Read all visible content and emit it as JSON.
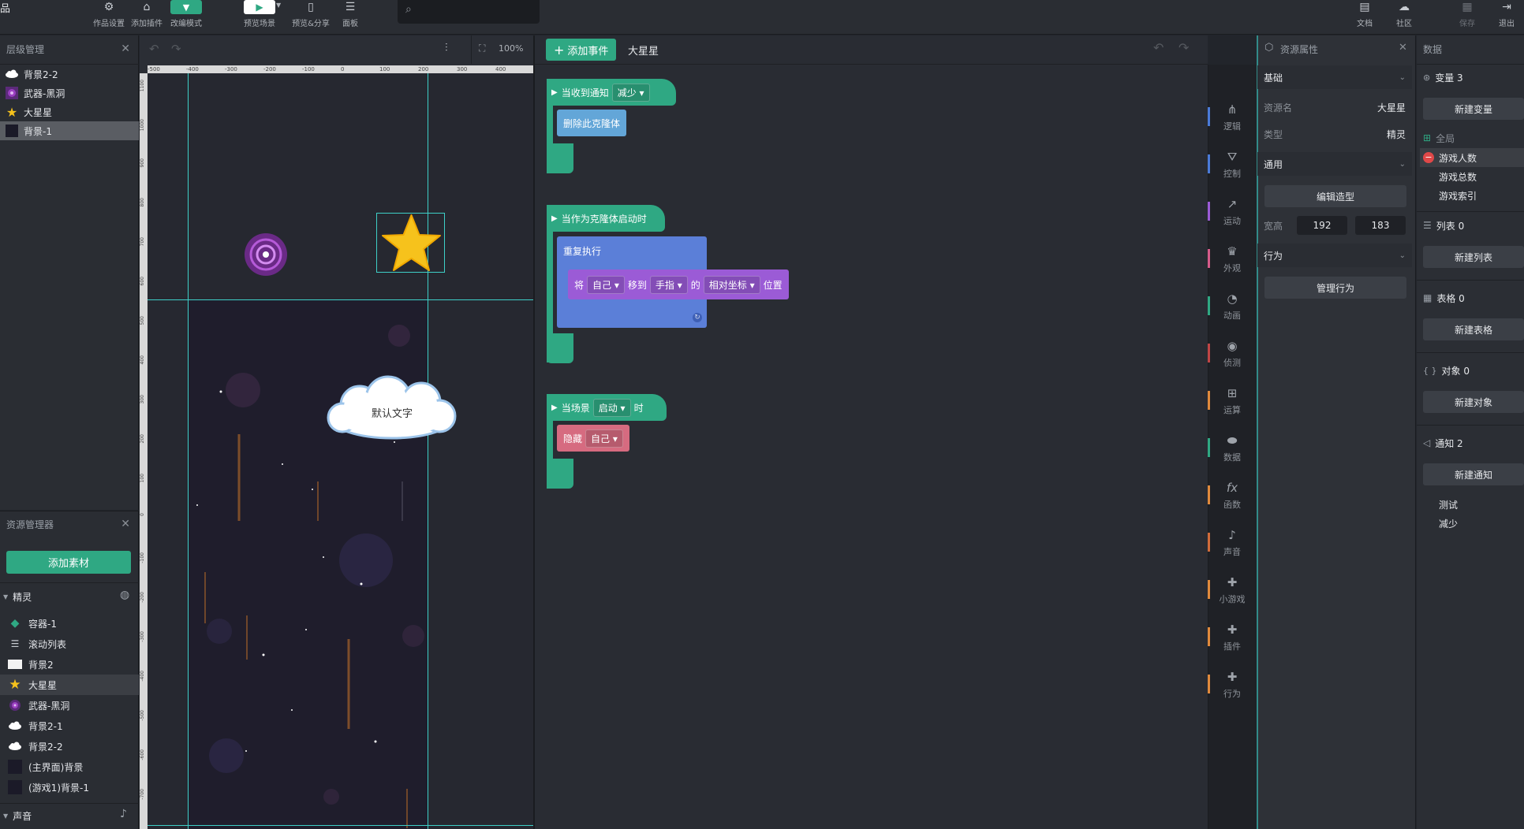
{
  "topbar": {
    "app_glyph": "品",
    "buttons": [
      {
        "label": "作品设置",
        "icon": "gear-icon"
      },
      {
        "label": "添加插件",
        "icon": "plugin-icon"
      },
      {
        "label": "改编模式",
        "icon": "shirt-icon"
      },
      {
        "label": "预览场景",
        "icon": "play-icon"
      },
      {
        "label": "预览&分享",
        "icon": "phone-icon"
      },
      {
        "label": "面板",
        "icon": "list-icon"
      }
    ],
    "right_buttons": [
      {
        "label": "文档",
        "icon": "book-icon"
      },
      {
        "label": "社区",
        "icon": "chat-icon"
      },
      {
        "label": "保存",
        "icon": "save-icon"
      },
      {
        "label": "退出",
        "icon": "exit-icon"
      }
    ]
  },
  "layers": {
    "title": "层级管理",
    "items": [
      {
        "label": "背景2-2",
        "icon": "cloud-icon",
        "selected": false
      },
      {
        "label": "武器-黑洞",
        "icon": "blackhole-icon",
        "selected": false
      },
      {
        "label": "大星星",
        "icon": "star-icon",
        "selected": false
      },
      {
        "label": "背景-1",
        "icon": "dark-square-icon",
        "selected": true
      }
    ]
  },
  "assets": {
    "title": "资源管理器",
    "add_button": "添加素材",
    "sprite_section": "精灵",
    "sprites": [
      {
        "label": "容器-1",
        "icon": "cube-icon"
      },
      {
        "label": "滚动列表",
        "icon": "list-icon"
      },
      {
        "label": "背景2",
        "icon": "white-rect-icon"
      },
      {
        "label": "大星星",
        "icon": "star-icon"
      },
      {
        "label": "武器-黑洞",
        "icon": "blackhole-icon"
      },
      {
        "label": "背景2-1",
        "icon": "cloud-icon"
      },
      {
        "label": "背景2-2",
        "icon": "cloud-icon"
      },
      {
        "label": "(主界面)背景",
        "icon": "dark-square-icon"
      },
      {
        "label": "(游戏1)背景-1",
        "icon": "dark-square-icon"
      }
    ],
    "sound_section": "声音"
  },
  "stage": {
    "zoom": "100%",
    "ruler_top": [
      "-500",
      "-400",
      "-300",
      "-200",
      "-100",
      "0",
      "100",
      "200",
      "300",
      "400"
    ],
    "ruler_left": [
      "1100",
      "1000",
      "900",
      "800",
      "700",
      "600",
      "500",
      "400",
      "300",
      "200",
      "100",
      "0",
      "-100",
      "-200",
      "-300",
      "-400",
      "-500",
      "-600",
      "-700"
    ],
    "cloud_text": "默认文字"
  },
  "events": {
    "add_event": "添加事件",
    "sprite_name": "大星星",
    "group1": {
      "hat": "当收到通知",
      "notice": "减少",
      "action": "删除此克隆体"
    },
    "group2": {
      "hat": "当作为克隆体启动时",
      "loop": "重复执行",
      "move_prefix": "将",
      "move_self": "自己",
      "move_to": "移到",
      "target": "手指",
      "of": "的",
      "coord": "相对坐标",
      "position": "位置"
    },
    "group3": {
      "hat": "当场景",
      "state": "启动",
      "suffix": "时",
      "action": "隐藏",
      "target": "自己"
    }
  },
  "categories": [
    {
      "label": "逻辑",
      "icon": "logic-icon",
      "color": "#4a7bd8"
    },
    {
      "label": "控制",
      "icon": "control-icon",
      "color": "#4a7bd8"
    },
    {
      "label": "运动",
      "icon": "motion-icon",
      "color": "#9b5bd6"
    },
    {
      "label": "外观",
      "icon": "looks-icon",
      "color": "#d65b8a"
    },
    {
      "label": "动画",
      "icon": "animation-icon",
      "color": "#2fa883"
    },
    {
      "label": "侦测",
      "icon": "sensing-icon",
      "color": "#c04545"
    },
    {
      "label": "运算",
      "icon": "operator-icon",
      "color": "#e08a3c"
    },
    {
      "label": "数据",
      "icon": "data-icon",
      "color": "#2fa883"
    },
    {
      "label": "函数",
      "icon": "function-icon",
      "color": "#e08a3c"
    },
    {
      "label": "声音",
      "icon": "sound-icon",
      "color": "#d06b3a"
    },
    {
      "label": "小游戏",
      "icon": "minigame-icon",
      "color": "#e08a3c"
    },
    {
      "label": "插件",
      "icon": "plugin-icon",
      "color": "#e08a3c"
    },
    {
      "label": "行为",
      "icon": "behavior-icon",
      "color": "#e08a3c"
    }
  ],
  "props": {
    "title": "资源属性",
    "basic": "基础",
    "name_label": "资源名",
    "name_value": "大星星",
    "type_label": "类型",
    "type_value": "精灵",
    "general": "通用",
    "edit_shape": "编辑造型",
    "size_label": "宽高",
    "width": "192",
    "height": "183",
    "behavior": "行为",
    "manage_behavior": "管理行为"
  },
  "data_panel": {
    "title": "数据",
    "variables": "变量 3",
    "new_variable": "新建变量",
    "global": "全局",
    "var_items": [
      "游戏人数",
      "游戏总数",
      "游戏索引"
    ],
    "lists": "列表 0",
    "new_list": "新建列表",
    "tables": "表格 0",
    "new_table": "新建表格",
    "objects": "对象 0",
    "new_object": "新建对象",
    "notices": "通知 2",
    "new_notice": "新建通知",
    "notice_items": [
      "测试",
      "减少"
    ]
  },
  "colors": {
    "accent": "#2fa883",
    "selected_row": "#5a5d63",
    "stage_guide": "#3ed0c8"
  }
}
